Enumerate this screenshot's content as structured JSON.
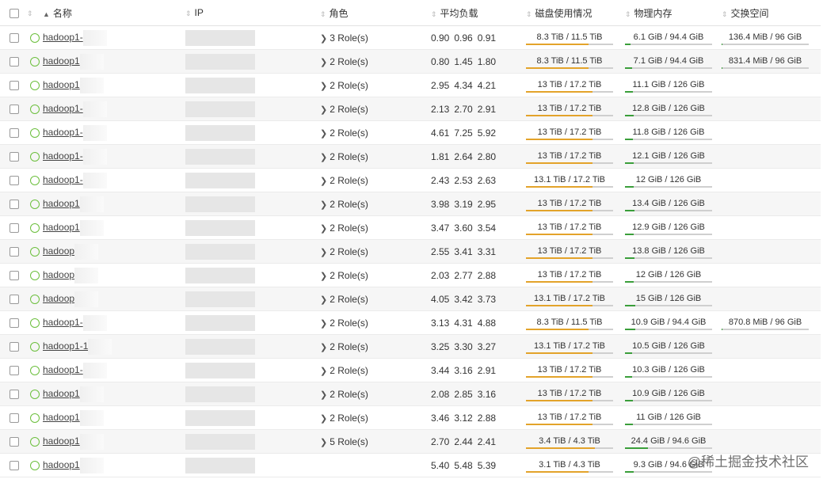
{
  "header": {
    "name": "名称",
    "ip": "IP",
    "role": "角色",
    "load": "平均负载",
    "disk": "磁盘使用情况",
    "mem": "物理内存",
    "swap": "交换空间"
  },
  "rows": [
    {
      "name": "hadoop1-",
      "role": "3 Role(s)",
      "load": [
        "0.90",
        "0.96",
        "0.91"
      ],
      "disk": "8.3 TiB / 11.5 TiB",
      "disk_pct": 72,
      "mem": "6.1 GiB / 94.4 GiB",
      "mem_pct": 6,
      "swap": "136.4 MiB / 96 GiB",
      "swap_pct": 1
    },
    {
      "name": "hadoop1",
      "role": "2 Role(s)",
      "load": [
        "0.80",
        "1.45",
        "1.80"
      ],
      "disk": "8.3 TiB / 11.5 TiB",
      "disk_pct": 72,
      "mem": "7.1 GiB / 94.4 GiB",
      "mem_pct": 8,
      "swap": "831.4 MiB / 96 GiB",
      "swap_pct": 1
    },
    {
      "name": "hadoop1",
      "role": "2 Role(s)",
      "load": [
        "2.95",
        "4.34",
        "4.21"
      ],
      "disk": "13 TiB / 17.2 TiB",
      "disk_pct": 76,
      "mem": "11.1 GiB / 126 GiB",
      "mem_pct": 9,
      "swap": "",
      "swap_pct": 0
    },
    {
      "name": "hadoop1-",
      "role": "2 Role(s)",
      "load": [
        "2.13",
        "2.70",
        "2.91"
      ],
      "disk": "13 TiB / 17.2 TiB",
      "disk_pct": 76,
      "mem": "12.8 GiB / 126 GiB",
      "mem_pct": 10,
      "swap": "",
      "swap_pct": 0
    },
    {
      "name": "hadoop1-",
      "role": "2 Role(s)",
      "load": [
        "4.61",
        "7.25",
        "5.92"
      ],
      "disk": "13 TiB / 17.2 TiB",
      "disk_pct": 76,
      "mem": "11.8 GiB / 126 GiB",
      "mem_pct": 9,
      "swap": "",
      "swap_pct": 0
    },
    {
      "name": "hadoop1-",
      "role": "2 Role(s)",
      "load": [
        "1.81",
        "2.64",
        "2.80"
      ],
      "disk": "13 TiB / 17.2 TiB",
      "disk_pct": 76,
      "mem": "12.1 GiB / 126 GiB",
      "mem_pct": 10,
      "swap": "",
      "swap_pct": 0
    },
    {
      "name": "hadoop1-",
      "role": "2 Role(s)",
      "load": [
        "2.43",
        "2.53",
        "2.63"
      ],
      "disk": "13.1 TiB / 17.2 TiB",
      "disk_pct": 76,
      "mem": "12 GiB / 126 GiB",
      "mem_pct": 10,
      "swap": "",
      "swap_pct": 0
    },
    {
      "name": "hadoop1",
      "role": "2 Role(s)",
      "load": [
        "3.98",
        "3.19",
        "2.95"
      ],
      "disk": "13 TiB / 17.2 TiB",
      "disk_pct": 76,
      "mem": "13.4 GiB / 126 GiB",
      "mem_pct": 11,
      "swap": "",
      "swap_pct": 0
    },
    {
      "name": "hadoop1",
      "role": "2 Role(s)",
      "load": [
        "3.47",
        "3.60",
        "3.54"
      ],
      "disk": "13 TiB / 17.2 TiB",
      "disk_pct": 76,
      "mem": "12.9 GiB / 126 GiB",
      "mem_pct": 10,
      "swap": "",
      "swap_pct": 0
    },
    {
      "name": "hadoop",
      "role": "2 Role(s)",
      "load": [
        "2.55",
        "3.41",
        "3.31"
      ],
      "disk": "13 TiB / 17.2 TiB",
      "disk_pct": 76,
      "mem": "13.8 GiB / 126 GiB",
      "mem_pct": 11,
      "swap": "",
      "swap_pct": 0
    },
    {
      "name": "hadoop",
      "role": "2 Role(s)",
      "load": [
        "2.03",
        "2.77",
        "2.88"
      ],
      "disk": "13 TiB / 17.2 TiB",
      "disk_pct": 76,
      "mem": "12 GiB / 126 GiB",
      "mem_pct": 10,
      "swap": "",
      "swap_pct": 0
    },
    {
      "name": "hadoop",
      "role": "2 Role(s)",
      "load": [
        "4.05",
        "3.42",
        "3.73"
      ],
      "disk": "13.1 TiB / 17.2 TiB",
      "disk_pct": 76,
      "mem": "15 GiB / 126 GiB",
      "mem_pct": 12,
      "swap": "",
      "swap_pct": 0
    },
    {
      "name": "hadoop1-",
      "role": "2 Role(s)",
      "load": [
        "3.13",
        "4.31",
        "4.88"
      ],
      "disk": "8.3 TiB / 11.5 TiB",
      "disk_pct": 72,
      "mem": "10.9 GiB / 94.4 GiB",
      "mem_pct": 12,
      "swap": "870.8 MiB / 96 GiB",
      "swap_pct": 1
    },
    {
      "name": "hadoop1-1",
      "role": "2 Role(s)",
      "load": [
        "3.25",
        "3.30",
        "3.27"
      ],
      "disk": "13.1 TiB / 17.2 TiB",
      "disk_pct": 76,
      "mem": "10.5 GiB / 126 GiB",
      "mem_pct": 8,
      "swap": "",
      "swap_pct": 0
    },
    {
      "name": "hadoop1-",
      "role": "2 Role(s)",
      "load": [
        "3.44",
        "3.16",
        "2.91"
      ],
      "disk": "13 TiB / 17.2 TiB",
      "disk_pct": 76,
      "mem": "10.3 GiB / 126 GiB",
      "mem_pct": 8,
      "swap": "",
      "swap_pct": 0
    },
    {
      "name": "hadoop1",
      "role": "2 Role(s)",
      "load": [
        "2.08",
        "2.85",
        "3.16"
      ],
      "disk": "13 TiB / 17.2 TiB",
      "disk_pct": 76,
      "mem": "10.9 GiB / 126 GiB",
      "mem_pct": 9,
      "swap": "",
      "swap_pct": 0
    },
    {
      "name": "hadoop1",
      "role": "2 Role(s)",
      "load": [
        "3.46",
        "3.12",
        "2.88"
      ],
      "disk": "13 TiB / 17.2 TiB",
      "disk_pct": 76,
      "mem": "11 GiB / 126 GiB",
      "mem_pct": 9,
      "swap": "",
      "swap_pct": 0
    },
    {
      "name": "hadoop1",
      "role": "5 Role(s)",
      "load": [
        "2.70",
        "2.44",
        "2.41"
      ],
      "disk": "3.4 TiB / 4.3 TiB",
      "disk_pct": 79,
      "mem": "24.4 GiB / 94.6 GiB",
      "mem_pct": 26,
      "swap": "",
      "swap_pct": 0
    },
    {
      "name": "hadoop1",
      "role": "",
      "load": [
        "5.40",
        "5.48",
        "5.39"
      ],
      "disk": "3.1 TiB / 4.3 TiB",
      "disk_pct": 72,
      "mem": "9.3 GiB / 94.6 GiB",
      "mem_pct": 10,
      "swap": "",
      "swap_pct": 0
    }
  ],
  "watermark": "@稀土掘金技术社区"
}
